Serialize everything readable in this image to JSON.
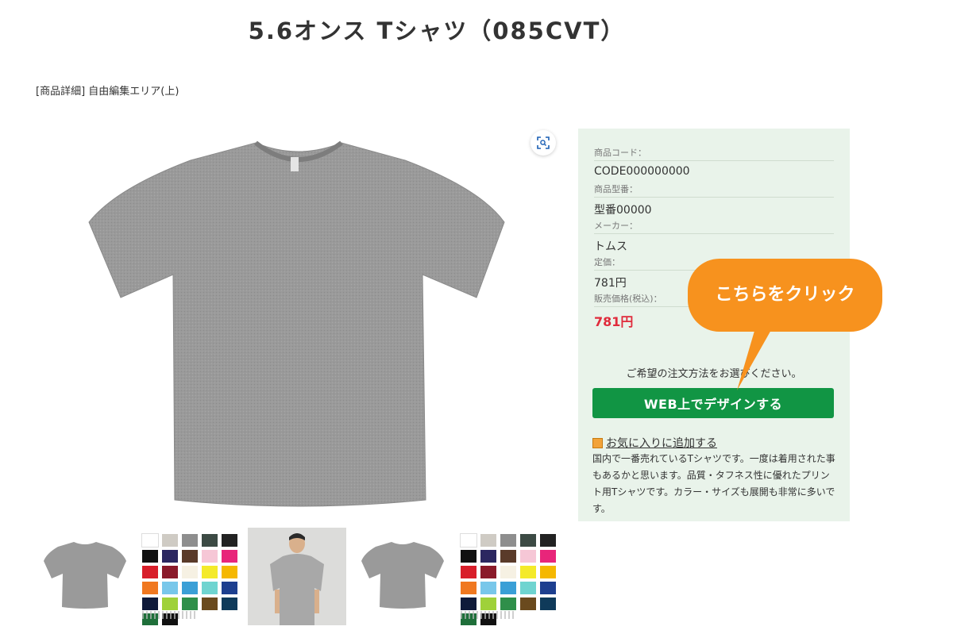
{
  "product": {
    "title": "5.6オンス Tシャツ（085CVT）",
    "free_area_label": "[商品詳細] 自由編集エリア(上)"
  },
  "specs": {
    "code_label": "商品コード：",
    "code_value": "CODE000000000",
    "model_label": "商品型番：",
    "model_value": "型番00000",
    "maker_label": "メーカー：",
    "maker_value": "トムス",
    "list_price_label": "定価：",
    "list_price_value": "781円",
    "sale_price_label": "販売価格(税込)：",
    "sale_price_value": "781円"
  },
  "order": {
    "prompt": "ご希望の注文方法をお選びください。",
    "design_button": "WEB上でデザインする",
    "favorite_link": "お気に入りに追加する"
  },
  "description": "国内で一番売れているTシャツです。一度は着用された事もあるかと思います。品質・タフネス性に優れたプリント用Tシャツです。カラー・サイズも展開も非常に多いです。",
  "callout": {
    "text": "こちらをクリック"
  },
  "colors": {
    "shirt_gray": "#9a9a9a",
    "panel_bg": "#e9f3ea",
    "button_green": "#119544",
    "price_red": "#e02b3c",
    "callout_orange": "#f7921e"
  },
  "swatches": [
    "#ffffff",
    "#cfcbc4",
    "#8e8e8e",
    "#3c4a44",
    "#222222",
    "#111111",
    "#2b2760",
    "#5a3b2a",
    "#f6c7d6",
    "#e8257a",
    "#d81e2a",
    "#8a1a2a",
    "#f6f1e3",
    "#f4ea2a",
    "#f5b800",
    "#f07820",
    "#78c7ea",
    "#3a9fd6",
    "#6fd4d0",
    "#1d3f8f",
    "#0f1a3a",
    "#9fd13a",
    "#2f8f4a",
    "#6a4a1e",
    "#0f3a5a",
    "#1f6f3a",
    "#111111"
  ]
}
